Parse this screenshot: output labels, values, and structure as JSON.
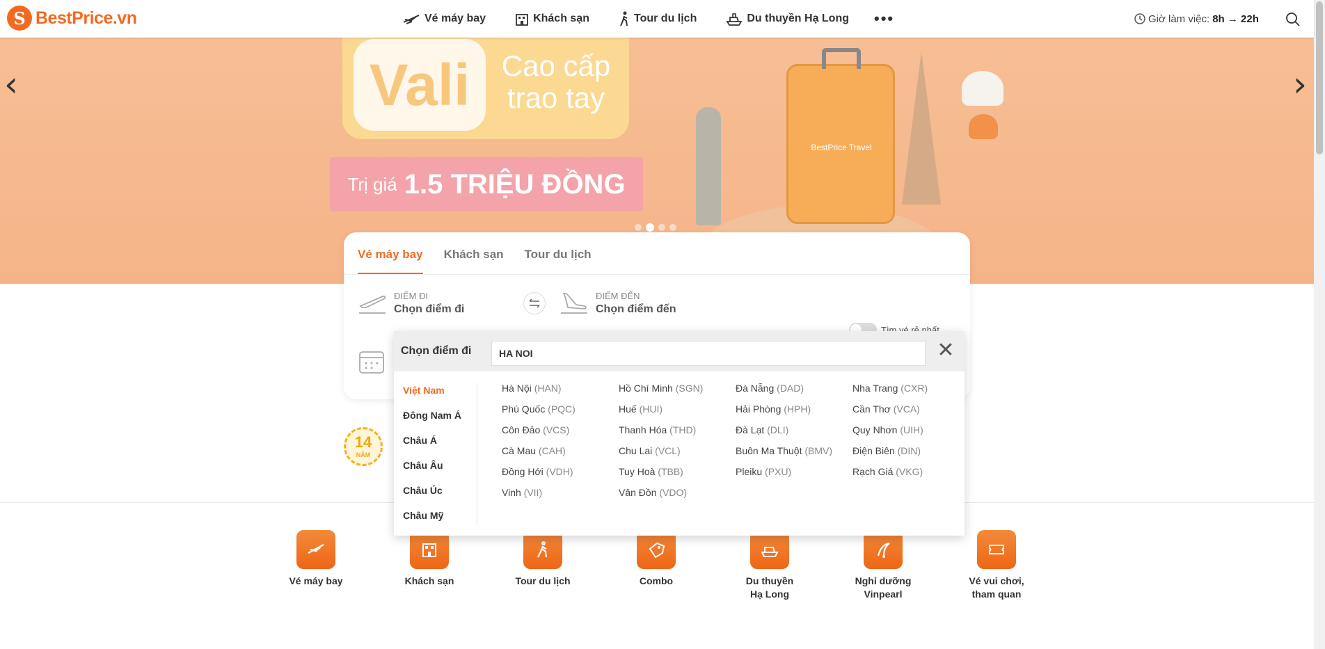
{
  "header": {
    "logo_text": "BestPrice.vn",
    "nav": [
      {
        "label": "Vé máy bay",
        "icon": "plane-icon"
      },
      {
        "label": "Khách sạn",
        "icon": "hotel-icon"
      },
      {
        "label": "Tour du lịch",
        "icon": "walker-icon"
      },
      {
        "label": "Du thuyền Hạ Long",
        "icon": "cruise-icon"
      }
    ],
    "more": "•••",
    "hours_label": "Giờ làm việc:",
    "hours_value": "8h → 22h"
  },
  "banner": {
    "prev": "‹",
    "next": "›",
    "vali": "Vali",
    "vali_sub": "Cao cấp trao tay",
    "price_small": "Trị giá",
    "price_big": "1.5 TRIỆU ĐỒNG",
    "suitcase_brand": "BestPrice Travel"
  },
  "search": {
    "tabs": [
      "Vé máy bay",
      "Khách sạn",
      "Tour du lịch"
    ],
    "from_label": "ĐIỂM ĐI",
    "from_value": "Chọn điểm đi",
    "to_label": "ĐIỂM ĐẾN",
    "to_value": "Chọn điểm đến",
    "cheap_label": "Tìm vé rẻ nhất"
  },
  "dropdown": {
    "title": "Chọn điểm đi",
    "input_value": "HA NOI",
    "close": "✕",
    "regions": [
      "Việt Nam",
      "Đông Nam Á",
      "Châu Á",
      "Châu Âu",
      "Châu Úc",
      "Châu Mỹ"
    ],
    "active_region": "Việt Nam",
    "cities": [
      {
        "name": "Hà Nội",
        "code": "(HAN)"
      },
      {
        "name": "Hồ Chí Minh",
        "code": "(SGN)"
      },
      {
        "name": "Đà Nẵng",
        "code": "(DAD)"
      },
      {
        "name": "Nha Trang",
        "code": "(CXR)"
      },
      {
        "name": "Phú Quốc",
        "code": "(PQC)"
      },
      {
        "name": "Huế",
        "code": "(HUI)"
      },
      {
        "name": "Hải Phòng",
        "code": "(HPH)"
      },
      {
        "name": "Cần Thơ",
        "code": "(VCA)"
      },
      {
        "name": "Côn Đảo",
        "code": "(VCS)"
      },
      {
        "name": "Thanh Hóa",
        "code": "(THD)"
      },
      {
        "name": "Đà Lạt",
        "code": "(DLI)"
      },
      {
        "name": "Quy Nhơn",
        "code": "(UIH)"
      },
      {
        "name": "Cà Mau",
        "code": "(CAH)"
      },
      {
        "name": "Chu Lai",
        "code": "(VCL)"
      },
      {
        "name": "Buôn Ma Thuột",
        "code": "(BMV)"
      },
      {
        "name": "Điện Biên",
        "code": "(DIN)"
      },
      {
        "name": "Đồng Hới",
        "code": "(VDH)"
      },
      {
        "name": "Tuy Hoà",
        "code": "(TBB)"
      },
      {
        "name": "Pleiku",
        "code": "(PXU)"
      },
      {
        "name": "Rạch Giá",
        "code": "(VKG)"
      },
      {
        "name": "Vinh",
        "code": "(VII)"
      },
      {
        "name": "Vân Đồn",
        "code": "(VDO)"
      }
    ]
  },
  "award": {
    "number": "14",
    "unit": "NĂM"
  },
  "services": [
    {
      "label": "Vé máy bay",
      "icon": "plane-icon"
    },
    {
      "label": "Khách sạn",
      "icon": "hotel-icon"
    },
    {
      "label": "Tour du lịch",
      "icon": "walker-icon"
    },
    {
      "label": "Combo",
      "icon": "combo-tag-icon"
    },
    {
      "label": "Du thuyền\nHạ Long",
      "icon": "cruise-icon"
    },
    {
      "label": "Nghỉ dưỡng\nVinpearl",
      "icon": "vinpearl-icon"
    },
    {
      "label": "Vé vui chơi,\ntham quan",
      "icon": "ticket-icon"
    }
  ],
  "colors": {
    "accent": "#f26a22",
    "banner": "#f7be95",
    "hot": "#f23c3c"
  }
}
